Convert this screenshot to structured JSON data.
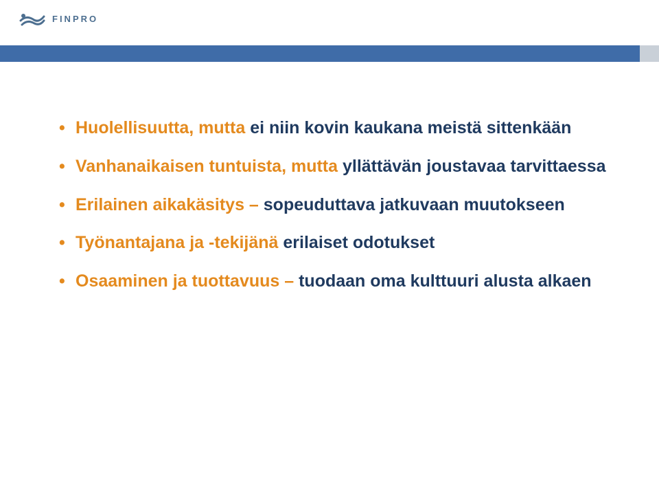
{
  "brand": {
    "name": "FINPRO"
  },
  "colors": {
    "accent_orange": "#e48a1e",
    "accent_navy": "#1f3a5f",
    "header_blue": "#3f6ca8"
  },
  "bullets": [
    {
      "segments": [
        {
          "text": "Huolellisuutta, mutta ",
          "color": "orange"
        },
        {
          "text": "ei niin kovin kaukana meistä sittenkään",
          "color": "navy"
        }
      ]
    },
    {
      "segments": [
        {
          "text": "Vanhanaikaisen tuntuista, mutta ",
          "color": "orange"
        },
        {
          "text": "yllättävän joustavaa tarvittaessa",
          "color": "navy"
        }
      ]
    },
    {
      "segments": [
        {
          "text": "Erilainen aikakäsitys – ",
          "color": "orange"
        },
        {
          "text": "sopeuduttava jatkuvaan muutokseen",
          "color": "navy"
        }
      ]
    },
    {
      "segments": [
        {
          "text": "Työnantajana ja -tekijänä ",
          "color": "orange"
        },
        {
          "text": "erilaiset odotukset",
          "color": "navy"
        }
      ]
    },
    {
      "segments": [
        {
          "text": "Osaaminen ja tuottavuus – ",
          "color": "orange"
        },
        {
          "text": "tuodaan oma kulttuuri alusta alkaen",
          "color": "navy"
        }
      ]
    }
  ]
}
